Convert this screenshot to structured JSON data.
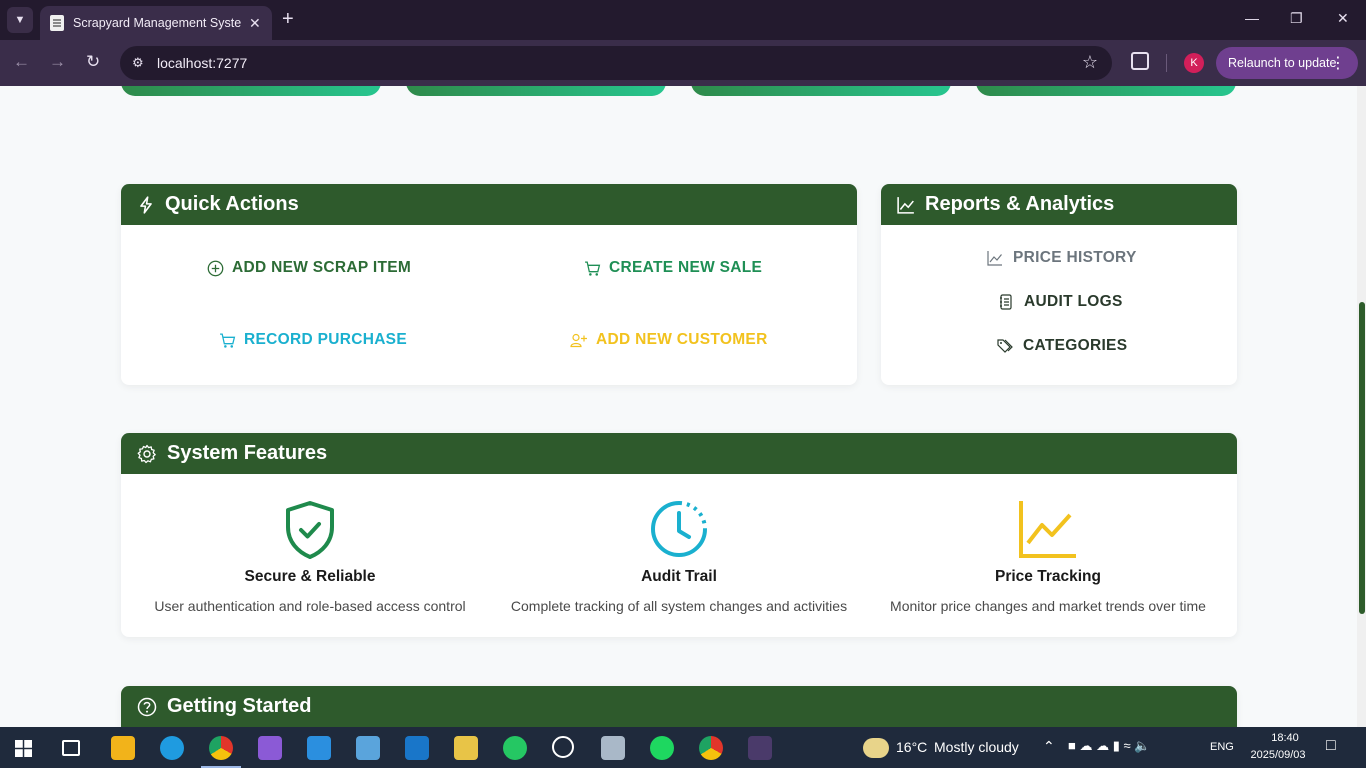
{
  "browser": {
    "tab_title": "Scrapyard Management System",
    "url": "localhost:7277",
    "profile_initial": "K",
    "relaunch_label": "Relaunch to update"
  },
  "quick_actions": {
    "title": "Quick Actions",
    "buttons": [
      {
        "label": "ADD NEW SCRAP ITEM",
        "icon": "plus-circle-icon",
        "color": "#2c6b35"
      },
      {
        "label": "CREATE NEW SALE",
        "icon": "cart-icon",
        "color": "#1f8f55"
      },
      {
        "label": "RECORD PURCHASE",
        "icon": "cart-icon",
        "color": "#1ab0cf"
      },
      {
        "label": "ADD NEW CUSTOMER",
        "icon": "person-add-icon",
        "color": "#f2c21e"
      }
    ]
  },
  "reports": {
    "title": "Reports & Analytics",
    "items": [
      {
        "label": "PRICE HISTORY",
        "icon": "line-chart-icon"
      },
      {
        "label": "AUDIT LOGS",
        "icon": "journal-icon"
      },
      {
        "label": "CATEGORIES",
        "icon": "tags-icon"
      }
    ]
  },
  "system_features": {
    "title": "System Features",
    "features": [
      {
        "title": "Secure & Reliable",
        "desc": "User authentication and role-based access control",
        "icon": "shield-check-icon"
      },
      {
        "title": "Audit Trail",
        "desc": "Complete tracking of all system changes and activities",
        "icon": "clock-history-icon"
      },
      {
        "title": "Price Tracking",
        "desc": "Monitor price changes and market trends over time",
        "icon": "graph-up-icon"
      }
    ]
  },
  "getting_started": {
    "title": "Getting Started"
  },
  "colors": {
    "header_green": "#2e5a2c",
    "accent_teal": "#27c68f",
    "accent_cyan": "#1ab0cf",
    "accent_yellow": "#f2c21e"
  },
  "taskbar": {
    "weather_temp": "16°C",
    "weather_text": "Mostly cloudy",
    "lang": "ENG",
    "time": "18:40",
    "date": "2025/09/03"
  }
}
